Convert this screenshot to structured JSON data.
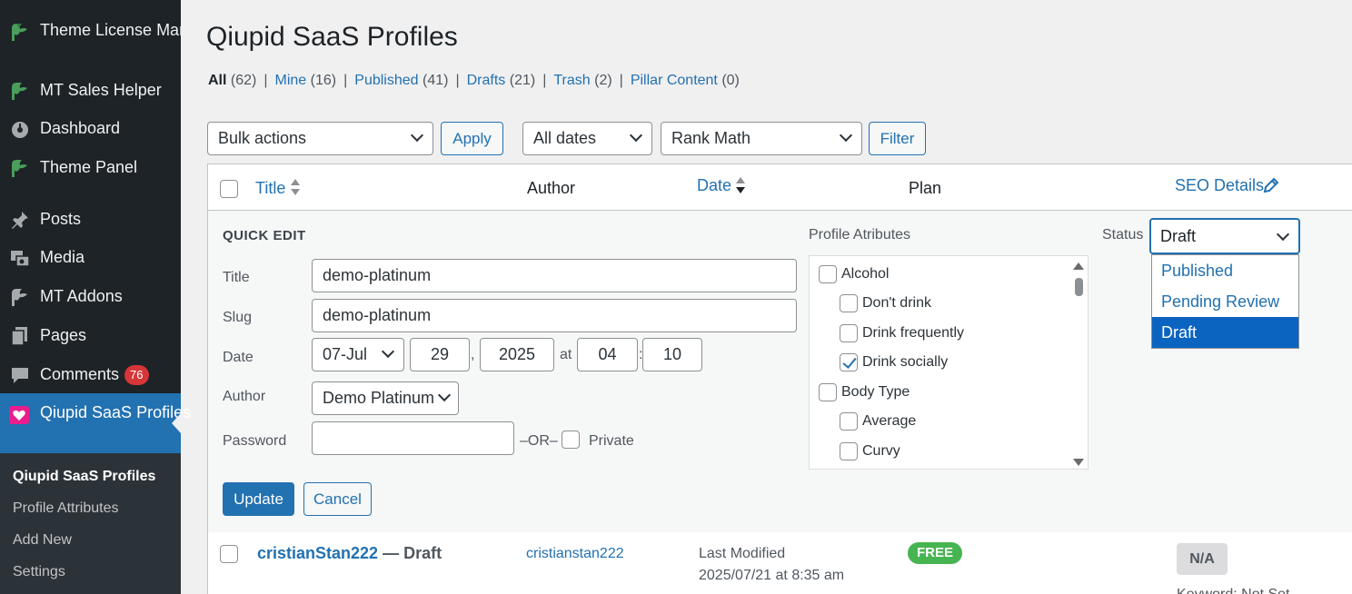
{
  "sidebar": {
    "items": [
      {
        "label": "Theme License Manager",
        "icon": "leaf-icon"
      },
      {
        "label": "MT Sales Helper",
        "icon": "leaf-icon"
      },
      {
        "label": "Dashboard",
        "icon": "dashboard-icon"
      },
      {
        "label": "Theme Panel",
        "icon": "leaf-icon"
      },
      {
        "label": "Posts",
        "icon": "pin-icon"
      },
      {
        "label": "Media",
        "icon": "media-icon"
      },
      {
        "label": "MT Addons",
        "icon": "leaf-icon"
      },
      {
        "label": "Pages",
        "icon": "pages-icon"
      },
      {
        "label": "Comments",
        "icon": "comment-icon",
        "badge": "76"
      },
      {
        "label": "Qiupid SaaS Profiles",
        "icon": "heart-icon"
      }
    ],
    "submenu": [
      "Qiupid SaaS Profiles",
      "Profile Attributes",
      "Add New",
      "Settings"
    ]
  },
  "page": {
    "title": "Qiupid SaaS Profiles"
  },
  "views": [
    {
      "label": "All",
      "count": "(62)"
    },
    {
      "label": "Mine",
      "count": "(16)"
    },
    {
      "label": "Published",
      "count": "(41)"
    },
    {
      "label": "Drafts",
      "count": "(21)"
    },
    {
      "label": "Trash",
      "count": "(2)"
    },
    {
      "label": "Pillar Content",
      "count": "(0)"
    }
  ],
  "toolbar": {
    "bulk_actions": "Bulk actions",
    "apply": "Apply",
    "dates": "All dates",
    "seo_filter": "Rank Math",
    "filter": "Filter"
  },
  "table": {
    "columns": {
      "title": "Title",
      "author": "Author",
      "date": "Date",
      "plan": "Plan",
      "seo": "SEO Details"
    }
  },
  "quick_edit": {
    "heading": "QUICK EDIT",
    "title_label": "Title",
    "title_value": "demo-platinum",
    "slug_label": "Slug",
    "slug_value": "demo-platinum",
    "date_label": "Date",
    "month": "07-Jul",
    "day": "29",
    "comma": ",",
    "year": "2025",
    "at": "at",
    "hour": "04",
    "colon": ":",
    "minute": "10",
    "author_label": "Author",
    "author_value": "Demo Platinum",
    "password_label": "Password",
    "password_value": "",
    "or_text": "–OR–",
    "private_label": "Private",
    "attributes_label": "Profile Atributes",
    "attributes": [
      {
        "label": "Alcohol",
        "checked": false,
        "indent": 0
      },
      {
        "label": "Don't drink",
        "checked": false,
        "indent": 1
      },
      {
        "label": "Drink frequently",
        "checked": false,
        "indent": 1
      },
      {
        "label": "Drink socially",
        "checked": true,
        "indent": 1
      },
      {
        "label": "Body Type",
        "checked": false,
        "indent": 0
      },
      {
        "label": "Average",
        "checked": false,
        "indent": 1
      },
      {
        "label": "Curvy",
        "checked": false,
        "indent": 1
      }
    ],
    "status_label": "Status",
    "status_value": "Draft",
    "status_options": [
      "Published",
      "Pending Review",
      "Draft"
    ],
    "update": "Update",
    "cancel": "Cancel"
  },
  "rows": [
    {
      "title": "cristianStan222",
      "state": " — Draft",
      "author": "cristianstan222",
      "date_status": "Last Modified",
      "date_value": "2025/07/21 at 8:35 am",
      "plan": "FREE",
      "seo": "N/A",
      "seo_extra": "Keyword: Not Set"
    }
  ],
  "colors": {
    "sidebar_bg": "#1d2327",
    "accent": "#2271b1",
    "badge": "#d63638",
    "free": "#46b450"
  }
}
